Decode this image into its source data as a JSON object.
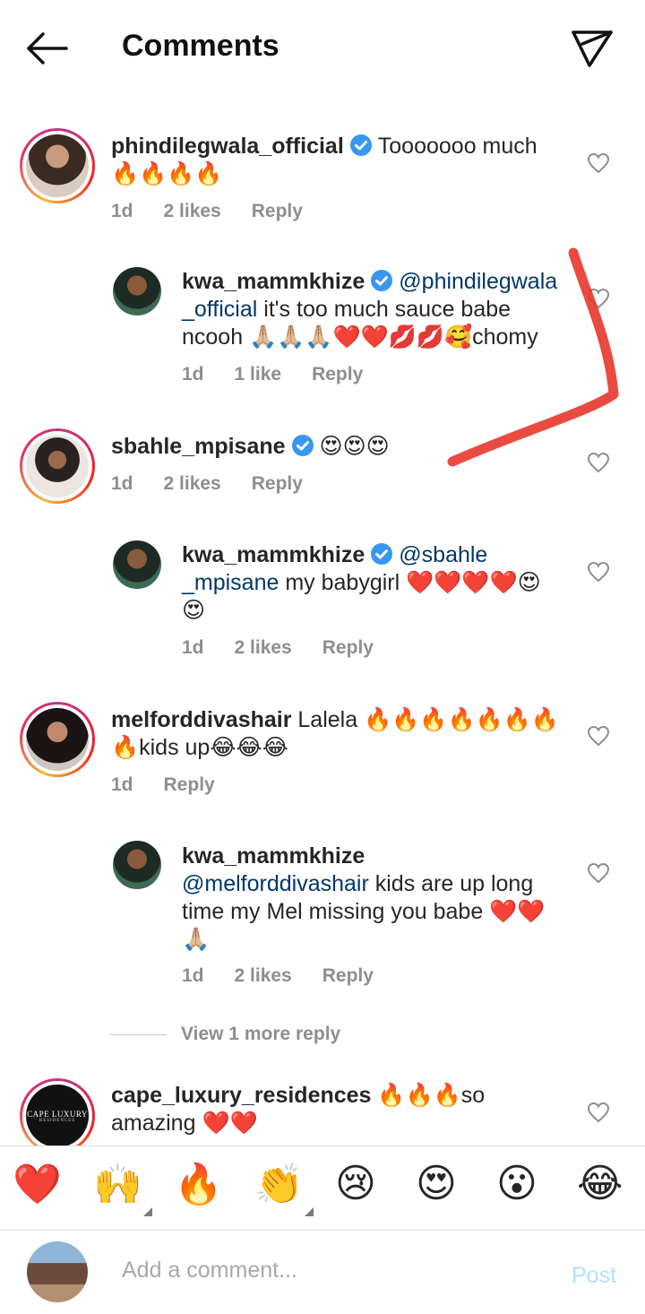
{
  "header": {
    "title": "Comments"
  },
  "icons": {
    "back": "arrow-left-icon",
    "send": "paper-plane-icon",
    "heart": "heart-outline-icon",
    "verified": "verified-badge-icon"
  },
  "colors": {
    "mention": "#00376b",
    "meta": "#8e8e8e",
    "post": "#b2dffc",
    "verified": "#3897f0",
    "scribble": "#e8372c"
  },
  "comments": [
    {
      "username": "phindilegwala_official",
      "text": "Tooooooo much",
      "emoji": "🔥🔥🔥🔥",
      "time": "1d",
      "likes": "2 likes",
      "reply": "Reply"
    },
    {
      "username": "kwa_mammkhize",
      "mention": "@phindilegwala _official",
      "text": " it's too much sauce babe ncooh 🙏🏼🙏🏼🙏🏼❤️❤️💋💋🥰chomy",
      "time": "1d",
      "likes": "1 like",
      "reply": "Reply"
    },
    {
      "username": "sbahle_mpisane",
      "text": "😍😍😍",
      "time": "1d",
      "likes": "2 likes",
      "reply": "Reply"
    },
    {
      "username": "kwa_mammkhize",
      "mention": "@sbahle _mpisane",
      "text": " my babygirl ❤️❤️❤️❤️😍 😍",
      "time": "1d",
      "likes": "2 likes",
      "reply": "Reply"
    },
    {
      "username": "melforddivashair",
      "text": "Lalela 🔥🔥🔥🔥🔥🔥🔥 🔥kids up😂😂😂",
      "time": "1d",
      "reply": "Reply"
    },
    {
      "username": "kwa_mammkhize",
      "mention": "@melforddivashair",
      "text": " kids are up long time my Mel missing you babe ❤️❤️ 🙏🏼",
      "time": "1d",
      "likes": "2 likes",
      "reply": "Reply"
    },
    {
      "username": "cape_luxury_residences",
      "text": "🔥🔥🔥so amazing ❤️❤️",
      "logo_text": "CAPE LUXURY",
      "logo_sub": "RESIDENCES"
    }
  ],
  "view_more": "View 1 more reply",
  "emoji_bar": [
    "❤️",
    "🙌",
    "🔥",
    "👏",
    "😢",
    "😍",
    "😮",
    "😂"
  ],
  "composer": {
    "placeholder": "Add a comment...",
    "post_label": "Post"
  }
}
